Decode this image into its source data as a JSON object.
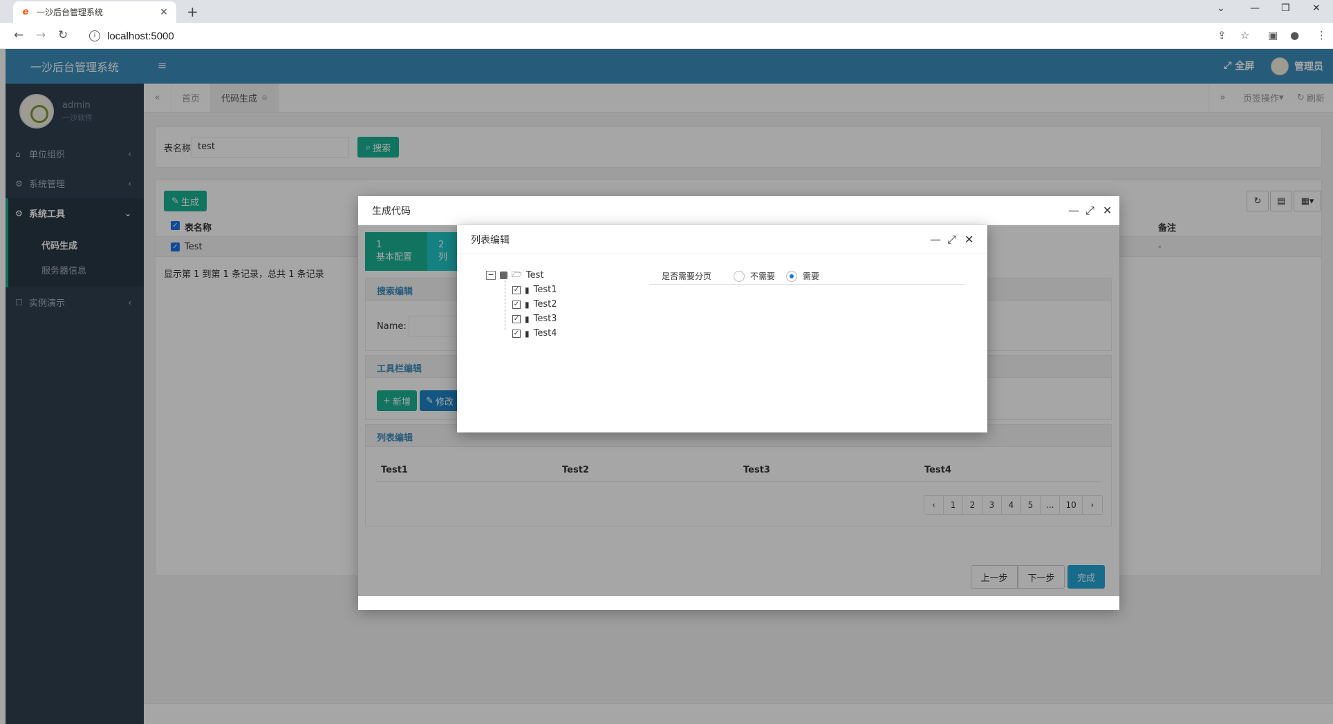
{
  "browser": {
    "tab_title": "一沙后台管理系统",
    "url": "localhost:5000"
  },
  "app": {
    "brand": "一沙后台管理系统",
    "user": {
      "name": "admin",
      "org": "一沙软件"
    },
    "menu": [
      {
        "label": "单位组织",
        "icon": "home-icon"
      },
      {
        "label": "系统管理",
        "icon": "gear-icon"
      },
      {
        "label": "系统工具",
        "icon": "gears-icon",
        "active": true,
        "children": [
          "代码生成",
          "服务器信息"
        ]
      },
      {
        "label": "实例演示",
        "icon": "square-icon"
      }
    ],
    "topbar": {
      "fullscreen": "全屏",
      "admin": "管理员"
    },
    "tabs": {
      "home": "首页",
      "current": "代码生成",
      "tab_ops": "页签操作",
      "refresh": "刷新"
    }
  },
  "page": {
    "search": {
      "label": "表名称:",
      "value": "test",
      "button": "搜索"
    },
    "generate_button": "生成",
    "table": {
      "headers": [
        "表名称",
        "备注"
      ],
      "rows": [
        {
          "name": "Test",
          "remark": "-"
        }
      ]
    },
    "summary": "显示第 1 到第 1 条记录，总共 1 条记录"
  },
  "modal1": {
    "title": "生成代码",
    "steps": [
      {
        "num": "1",
        "label": "基本配置"
      },
      {
        "num": "2",
        "label": "列"
      }
    ],
    "panels": {
      "search": "搜索编辑",
      "toolbar": "工具栏编辑",
      "list": "列表编辑"
    },
    "name_label": "Name:",
    "toolbar_buttons": {
      "add": "新增",
      "edit": "修改"
    },
    "list_columns": [
      "Test1",
      "Test2",
      "Test3",
      "Test4"
    ],
    "pager": [
      "‹",
      "1",
      "2",
      "3",
      "4",
      "5",
      "...",
      "10",
      "›"
    ],
    "buttons": {
      "prev": "上一步",
      "next": "下一步",
      "finish": "完成"
    }
  },
  "modal2": {
    "title": "列表编辑",
    "tree": {
      "root": "Test",
      "children": [
        "Test1",
        "Test2",
        "Test3",
        "Test4"
      ]
    },
    "paging": {
      "label": "是否需要分页",
      "options": [
        "不需要",
        "需要"
      ],
      "selected": "需要"
    }
  }
}
